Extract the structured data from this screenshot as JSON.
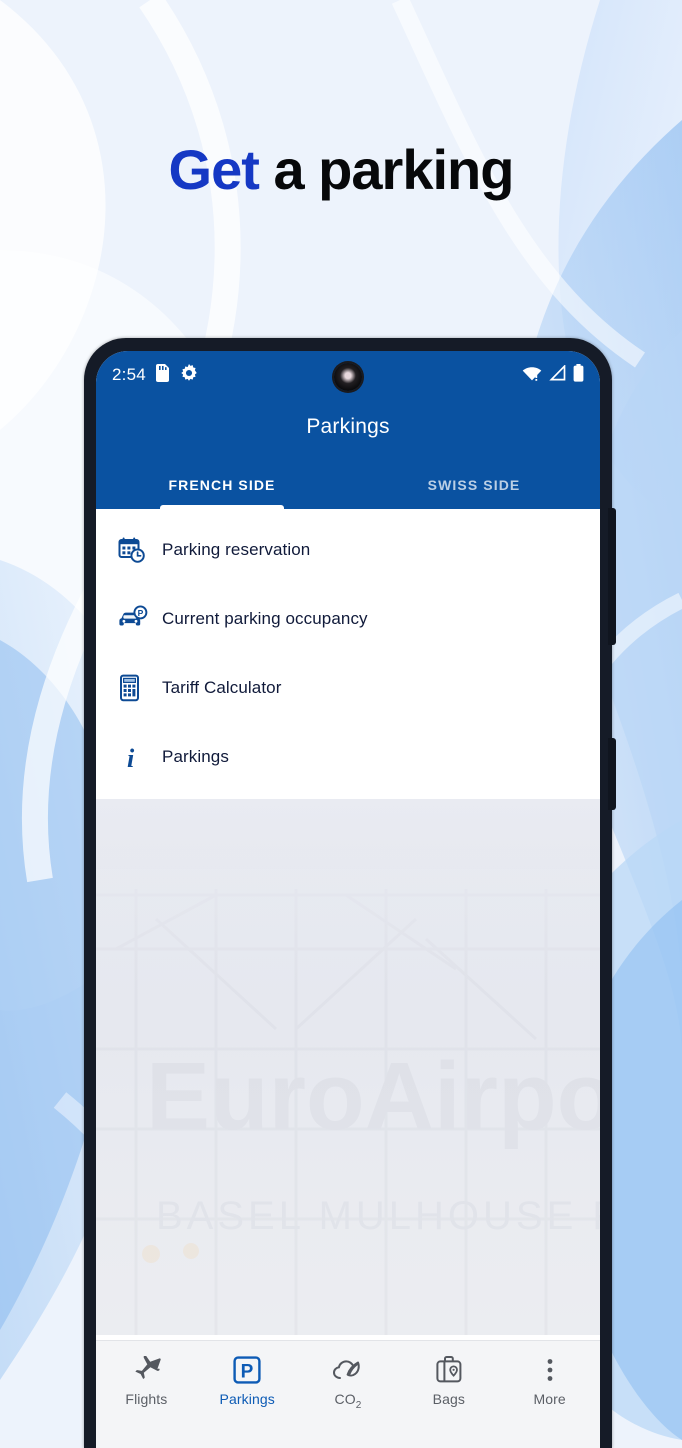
{
  "headline": {
    "highlight": "Get",
    "rest": " a parking",
    "highlight_color": "#1538c4",
    "rest_color": "#07080a"
  },
  "phone": {
    "status_bar": {
      "clock": "2:54",
      "left_icons": [
        "sd-card-icon",
        "gear-icon"
      ],
      "right_icons": [
        "wifi-alert-icon",
        "cellular-signal-icon",
        "battery-full-icon"
      ],
      "camera": "front-camera-punch-hole"
    },
    "app_bar": {
      "title": "Parkings",
      "brand_color": "#0a52a1",
      "tabs": [
        {
          "label": "FRENCH SIDE",
          "active": true
        },
        {
          "label": "SWISS SIDE",
          "active": false
        }
      ]
    },
    "menu": {
      "items": [
        {
          "label": "Parking reservation",
          "icon": "calendar-clock-icon"
        },
        {
          "label": "Current parking occupancy",
          "icon": "car-parking-icon"
        },
        {
          "label": "Tariff Calculator",
          "icon": "calculator-icon"
        },
        {
          "label": "Parkings",
          "icon": "info-icon"
        }
      ]
    },
    "background_photo": {
      "sign_main": "EuroAirport",
      "sign_sub": "BASEL MULHOUSE FREIBURG"
    },
    "bottom_nav": {
      "items": [
        {
          "label": "Flights",
          "icon": "airplane-icon",
          "active": false
        },
        {
          "label": "Parkings",
          "icon": "parking-p-icon",
          "active": true
        },
        {
          "label": "CO",
          "sub": "2",
          "icon": "co2-leaf-cloud-icon",
          "active": false
        },
        {
          "label": "Bags",
          "icon": "suitcase-icon",
          "active": false
        },
        {
          "label": "More",
          "icon": "more-dots-icon",
          "active": false
        }
      ]
    },
    "side_buttons": [
      "volume-button",
      "power-button"
    ]
  }
}
